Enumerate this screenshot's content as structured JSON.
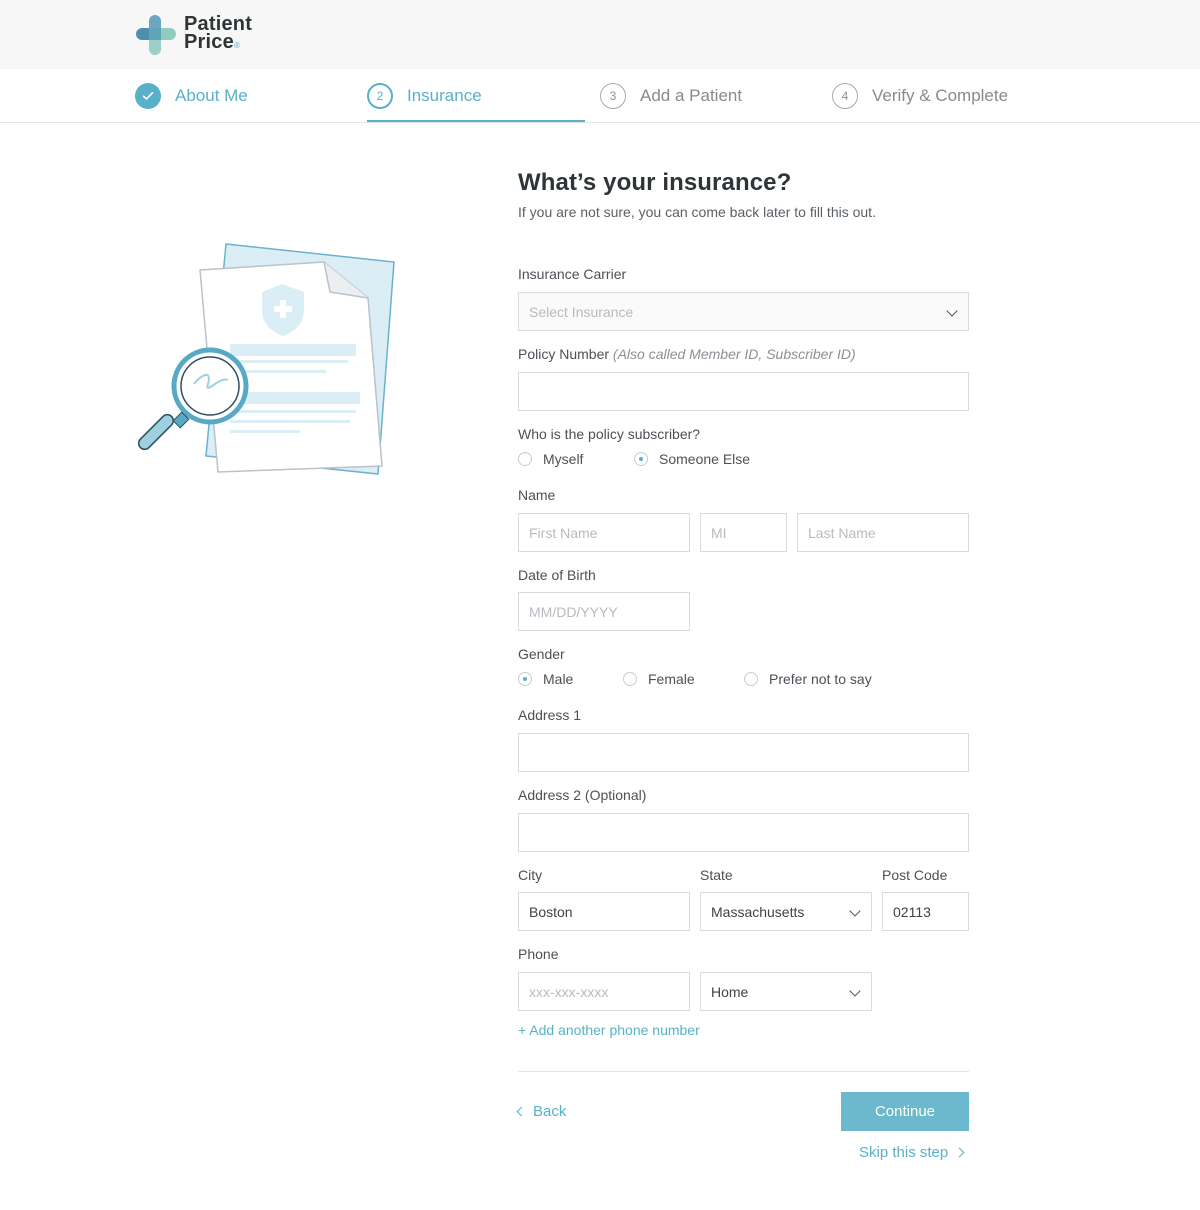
{
  "brand": {
    "line1": "Patient",
    "line2": "Price",
    "reg": "®"
  },
  "steps": [
    {
      "number": "1",
      "label": "About Me",
      "state": "done"
    },
    {
      "number": "2",
      "label": "Insurance",
      "state": "active"
    },
    {
      "number": "3",
      "label": "Add a Patient",
      "state": "todo"
    },
    {
      "number": "4",
      "label": "Verify & Complete",
      "state": "todo"
    }
  ],
  "form": {
    "title": "What’s your insurance?",
    "subtitle": "If you are not sure, you can come back later to fill this out.",
    "carrier": {
      "label": "Insurance Carrier",
      "placeholder": "Select Insurance"
    },
    "policy": {
      "label": "Policy Number",
      "hint": "(Also called Member ID, Subscriber ID)",
      "value": ""
    },
    "subscriber": {
      "label": "Who is the policy subscriber?",
      "options": [
        "Myself",
        "Someone Else"
      ],
      "selected": "Someone Else"
    },
    "name": {
      "label": "Name",
      "first_placeholder": "First Name",
      "mi_placeholder": "MI",
      "last_placeholder": "Last Name"
    },
    "dob": {
      "label": "Date of Birth",
      "placeholder": "MM/DD/YYYY"
    },
    "gender": {
      "label": "Gender",
      "options": [
        "Male",
        "Female",
        "Prefer not to say"
      ],
      "selected": "Male"
    },
    "address1": {
      "label": "Address 1",
      "value": ""
    },
    "address2": {
      "label": "Address 2 (Optional)",
      "value": ""
    },
    "city": {
      "label": "City",
      "value": "Boston"
    },
    "state": {
      "label": "State",
      "value": "Massachusetts"
    },
    "postcode": {
      "label": "Post Code",
      "value": "02113"
    },
    "phone": {
      "label": "Phone",
      "placeholder": "xxx-xxx-xxxx",
      "type": "Home"
    },
    "add_phone": "+ Add another phone number",
    "back": "Back",
    "continue": "Continue",
    "skip": "Skip this step"
  },
  "colors": {
    "accent": "#58b1c9",
    "button": "#6cb8cd",
    "border": "#d8dcdf"
  }
}
